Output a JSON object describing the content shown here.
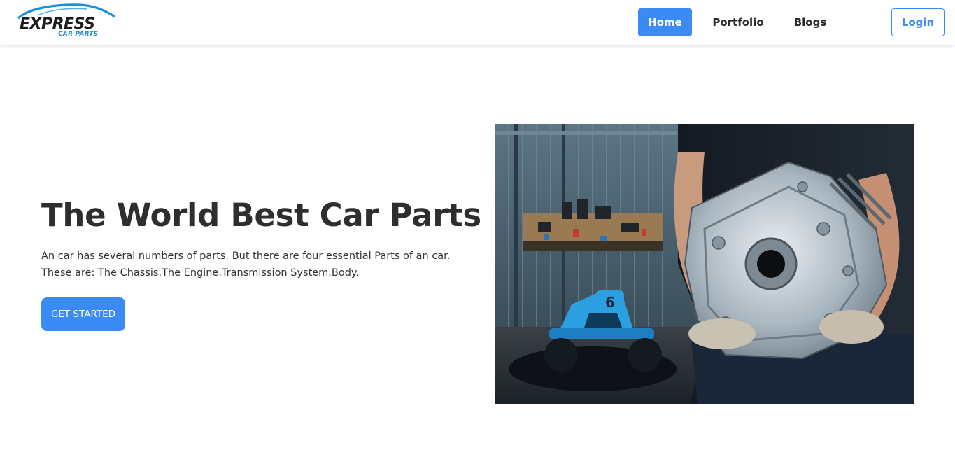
{
  "brand": {
    "logo_word": "EXPRESS",
    "logo_sub": "CAR PARTS",
    "primary_color": "#3a8bf5",
    "logo_accent_color": "#1a8fd6"
  },
  "nav": {
    "items": [
      {
        "label": "Home",
        "active": true
      },
      {
        "label": "Portfolio",
        "active": false
      },
      {
        "label": "Blogs",
        "active": false
      }
    ],
    "login_label": "Login"
  },
  "hero": {
    "title": "The World Best Car Parts",
    "description": "An car has several numbers of parts. But there are four essential Parts of an car. These are: The Chassis.The Engine.Transmission System.Body.",
    "cta_label": "GET STARTED",
    "image": {
      "kart_number": "6"
    }
  }
}
